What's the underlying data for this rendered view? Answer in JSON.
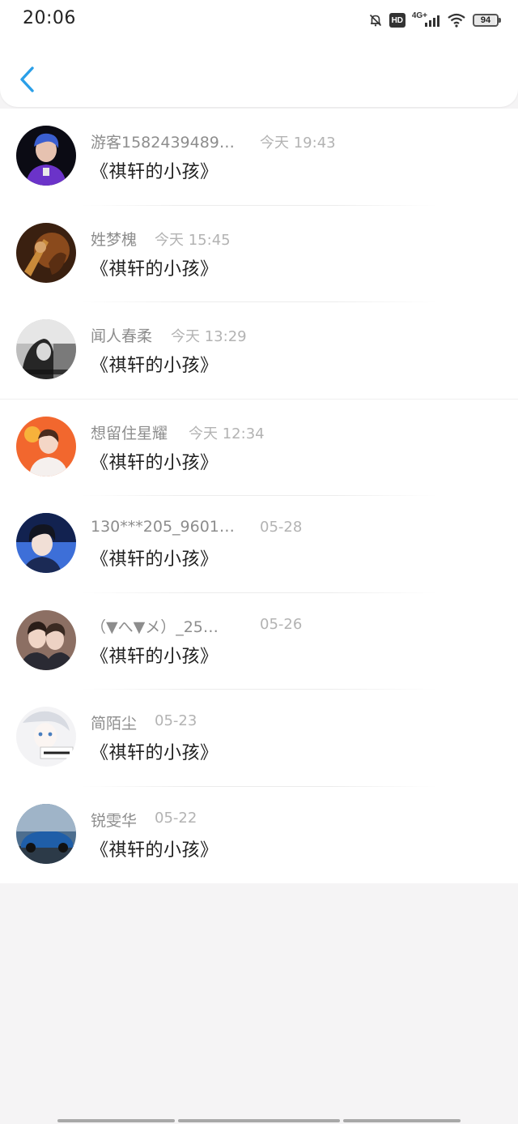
{
  "status_bar": {
    "time": "20:06",
    "hd_label": "HD",
    "network_label": "4G+",
    "battery": "94",
    "icons": [
      "mute-bell-icon",
      "hd-icon",
      "signal-icon",
      "wifi-icon",
      "battery-icon"
    ]
  },
  "nav": {
    "back_icon": "chevron-left-icon",
    "accent": "#2a9fe8"
  },
  "items": [
    {
      "user": "游客1582439489…",
      "time": "今天 19:43",
      "title": "《祺轩的小孩》",
      "avatar": "avatar-1"
    },
    {
      "user": "姓梦槐",
      "time": "今天 15:45",
      "title": "《祺轩的小孩》",
      "avatar": "avatar-2"
    },
    {
      "user": "闻人春柔",
      "time": "今天 13:29",
      "title": "《祺轩的小孩》",
      "avatar": "avatar-3"
    },
    {
      "user": "想留住星耀",
      "time": "今天 12:34",
      "title": "《祺轩的小孩》",
      "avatar": "avatar-4"
    },
    {
      "user": "130***205_9601…",
      "time": "05-28",
      "title": "《祺轩的小孩》",
      "avatar": "avatar-5"
    },
    {
      "user": "（▼へ▼メ）_25…",
      "time": "05-26",
      "title": "《祺轩的小孩》",
      "avatar": "avatar-6"
    },
    {
      "user": "简陌尘",
      "time": "05-23",
      "title": "《祺轩的小孩》",
      "avatar": "avatar-7"
    },
    {
      "user": "锐雯华",
      "time": "05-22",
      "title": "《祺轩的小孩》",
      "avatar": "avatar-8"
    }
  ]
}
